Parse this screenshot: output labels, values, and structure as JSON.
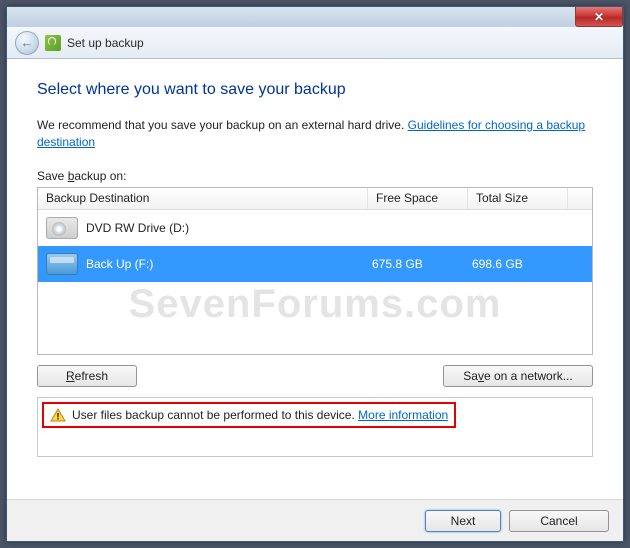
{
  "window": {
    "title": "Set up backup"
  },
  "heading": "Select where you want to save your backup",
  "recommend_text": "We recommend that you save your backup on an external hard drive. ",
  "guidelines_link": "Guidelines for choosing a backup destination",
  "save_label": "Save backup on:",
  "columns": {
    "dest": "Backup Destination",
    "free": "Free Space",
    "total": "Total Size"
  },
  "drives": [
    {
      "name": "DVD RW Drive (D:)",
      "free": "",
      "total": "",
      "icon": "dvd",
      "selected": false
    },
    {
      "name": "Back Up (F:)",
      "free": "675.8 GB",
      "total": "698.6 GB",
      "icon": "hdd",
      "selected": true
    }
  ],
  "buttons": {
    "refresh": "Refresh",
    "save_network": "Save on a network...",
    "next": "Next",
    "cancel": "Cancel"
  },
  "warning": {
    "text": "User files backup cannot be performed to this device. ",
    "link": "More information"
  },
  "watermark": "SevenForums.com"
}
